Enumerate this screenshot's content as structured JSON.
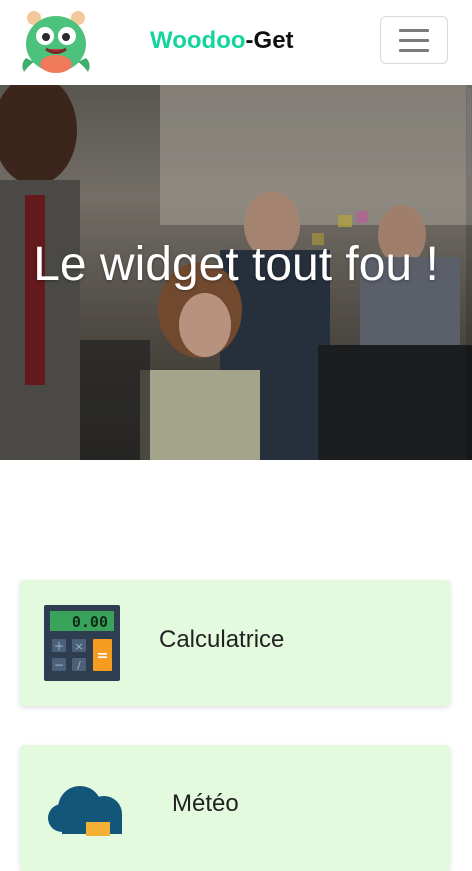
{
  "navbar": {
    "brand_accent": "Woodoo",
    "brand_rest": "-Get",
    "menu_button_icon": "hamburger-icon",
    "logo_icon": "green-monster-logo"
  },
  "hero": {
    "title": "Le widget tout fou !"
  },
  "widgets": [
    {
      "label": "Calculatrice",
      "icon": "calculator-icon",
      "display": "0.00"
    },
    {
      "label": "Météo",
      "icon": "weather-icon"
    }
  ],
  "colors": {
    "brand_accent": "#12d59a",
    "card_background": "#e3fadf"
  }
}
